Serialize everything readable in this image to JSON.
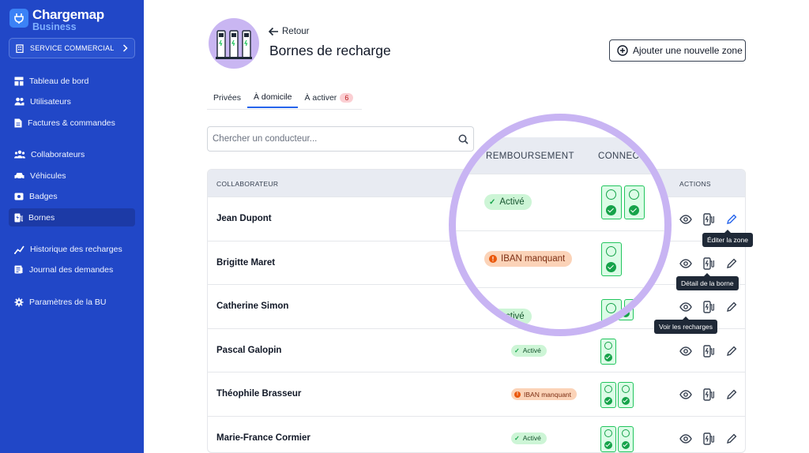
{
  "brand": {
    "name": "Chargemap",
    "sub": "Business"
  },
  "service": {
    "label": "SERVICE COMMERCIAL"
  },
  "sidebar": {
    "items": [
      {
        "label": "Tableau de bord",
        "icon": "dashboard-icon"
      },
      {
        "label": "Utilisateurs",
        "icon": "users-icon"
      },
      {
        "label": "Factures & commandes",
        "icon": "invoice-icon"
      },
      {
        "label": "Collaborateurs",
        "icon": "team-icon"
      },
      {
        "label": "Véhicules",
        "icon": "car-icon"
      },
      {
        "label": "Badges",
        "icon": "badge-icon"
      },
      {
        "label": "Bornes",
        "icon": "charger-icon"
      },
      {
        "label": "Historique des recharges",
        "icon": "history-icon"
      },
      {
        "label": "Journal des demandes",
        "icon": "journal-icon"
      },
      {
        "label": "Paramètres de la BU",
        "icon": "settings-icon"
      }
    ],
    "active": "Bornes"
  },
  "header": {
    "back": "Retour",
    "title": "Bornes de recharge",
    "add_button": "Ajouter une nouvelle zone"
  },
  "tabs": [
    {
      "label": "Privées"
    },
    {
      "label": "À domicile"
    },
    {
      "label": "À activer",
      "badge": "6"
    }
  ],
  "search": {
    "placeholder": "Chercher un conducteur..."
  },
  "table": {
    "columns": {
      "collaborator": "COLLABORATEUR",
      "actions": "ACTIONS"
    },
    "rows": [
      {
        "name": "Jean Dupont",
        "status": "Activé",
        "status_type": "ok",
        "connectors": 2
      },
      {
        "name": "Brigitte Maret",
        "status": "IBAN manquant",
        "status_type": "warn",
        "connectors": 1
      },
      {
        "name": "Catherine Simon",
        "status": "Activé",
        "status_type": "ok",
        "connectors": 2
      },
      {
        "name": "Pascal Galopin",
        "status": "Activé",
        "status_type": "ok",
        "connectors": 1
      },
      {
        "name": "Théophile Brasseur",
        "status": "IBAN manquant",
        "status_type": "warn",
        "connectors": 2
      },
      {
        "name": "Marie-France Cormier",
        "status": "Activé",
        "status_type": "ok",
        "connectors": 2
      }
    ]
  },
  "magnifier": {
    "col_reimbursement": "REMBOURSEMENT",
    "col_connectors": "CONNECTE"
  },
  "tooltips": {
    "edit": "Éditer la zone",
    "detail": "Détail de la borne",
    "view": "Voir les recharges"
  },
  "colors": {
    "sidebar": "#2147c7",
    "accent": "#2563eb",
    "magnifier_ring": "#c8b4f3",
    "ok": "#16a34a",
    "warn": "#ea580c"
  }
}
